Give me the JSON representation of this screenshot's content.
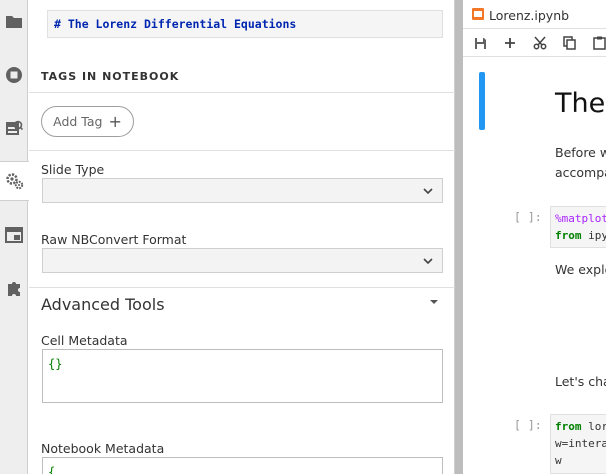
{
  "sidebar": {
    "icons": [
      "folder-icon",
      "running-icon",
      "commands-icon",
      "property-inspector-icon",
      "tabs-icon",
      "extensions-icon"
    ]
  },
  "inspector": {
    "cell_preview": "# The Lorenz Differential Equations",
    "tags_heading": "TAGS IN NOTEBOOK",
    "add_tag_label": "Add Tag",
    "slide_type_label": "Slide Type",
    "slide_type_value": "",
    "raw_format_label": "Raw NBConvert Format",
    "raw_format_value": "",
    "advanced_tools_label": "Advanced Tools",
    "cell_metadata_label": "Cell Metadata",
    "cell_metadata_value": "{}",
    "notebook_metadata_label": "Notebook Metadata",
    "notebook_metadata_value": "{"
  },
  "notebook": {
    "tab_title": "Lorenz.ipynb",
    "heading": "The",
    "text_line1": "Before w",
    "text_line2": "accompa",
    "prompt1": "[ ]:",
    "code1_line1_magic": "%matplot",
    "code1_line2_kw": "from",
    "code1_line2_rest": " ipy",
    "text_line3": "We explo",
    "text_line4": "Let's cha",
    "prompt2": "[ ]:",
    "code2_line1_kw": "from",
    "code2_line1_rest": " lor",
    "code2_line2": "w=intera",
    "code2_line3": "w"
  },
  "colors": {
    "accent": "#2196f3",
    "tab_icon": "#f37726",
    "heading_code": "#0026b0",
    "keyword": "#008000",
    "magic": "#aa22ff"
  }
}
